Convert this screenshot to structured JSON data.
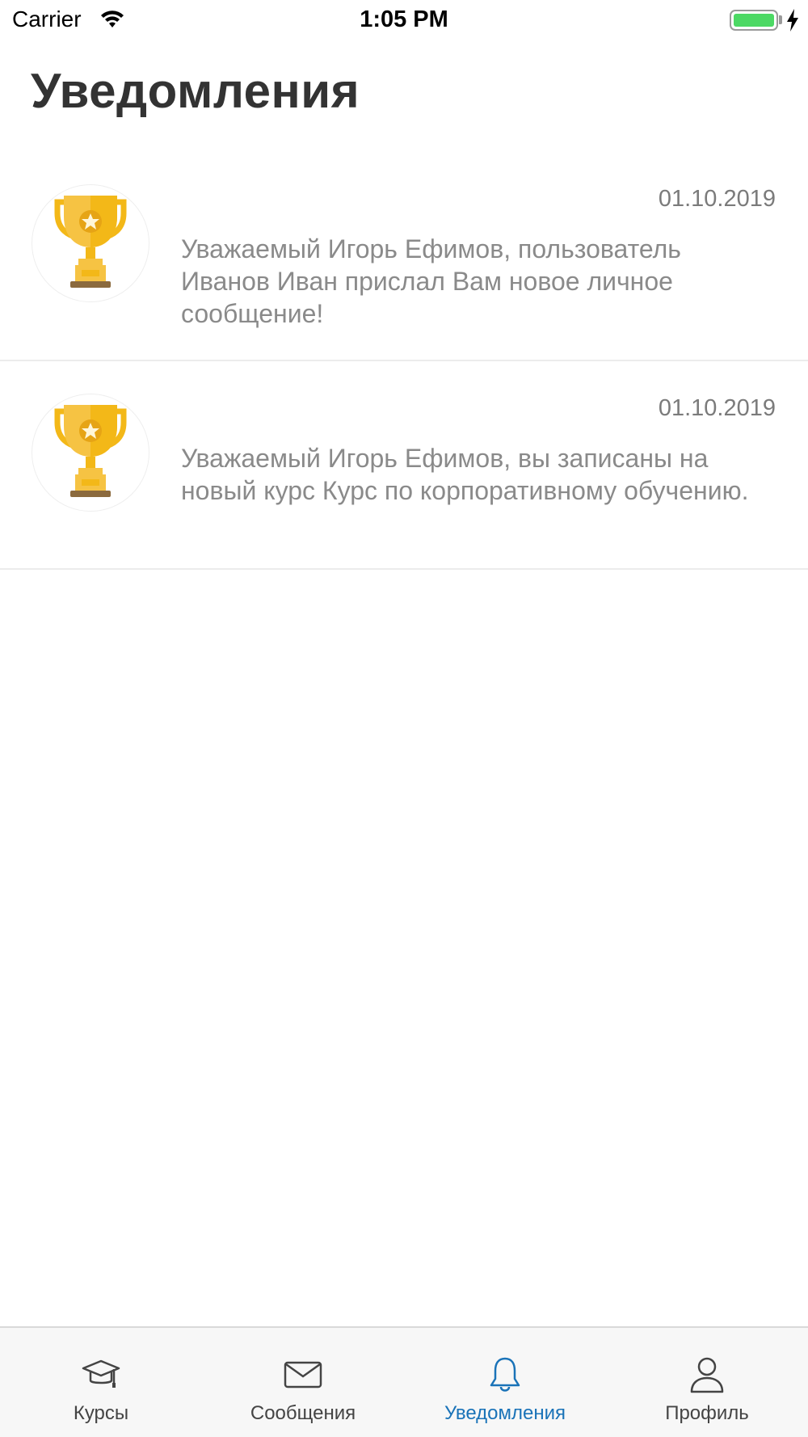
{
  "status_bar": {
    "carrier": "Carrier",
    "time": "1:05 PM"
  },
  "page": {
    "title": "Уведомления"
  },
  "notifications": [
    {
      "date": "01.10.2019",
      "text": "Уважаемый Игорь Ефимов, пользователь Иванов Иван прислал Вам новое личное сообщение!",
      "icon": "trophy-icon"
    },
    {
      "date": "01.10.2019",
      "text": "Уважаемый Игорь Ефимов, вы записаны на новый курс Курс по корпоративному обучению.",
      "icon": "trophy-icon"
    }
  ],
  "tab_bar": {
    "tabs": [
      {
        "label": "Курсы",
        "icon": "graduation-cap-icon",
        "active": false
      },
      {
        "label": "Сообщения",
        "icon": "envelope-icon",
        "active": false
      },
      {
        "label": "Уведомления",
        "icon": "bell-icon",
        "active": true
      },
      {
        "label": "Профиль",
        "icon": "user-icon",
        "active": false
      }
    ]
  },
  "colors": {
    "accent": "#1a73b8",
    "battery": "#4cd964",
    "trophy_gold": "#f6c343",
    "trophy_base": "#8b6a3e"
  }
}
